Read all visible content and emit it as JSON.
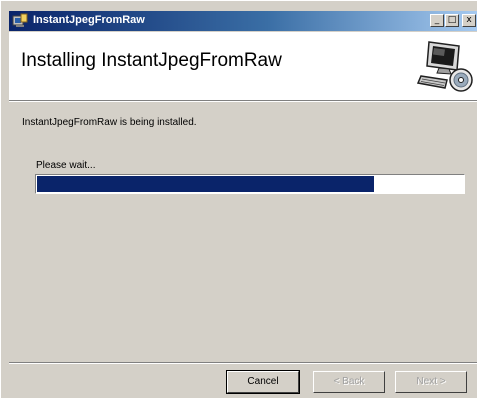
{
  "window": {
    "title": "InstantJpegFromRaw",
    "minimize_glyph": "_",
    "maximize_glyph": "□",
    "close_glyph": "x"
  },
  "header": {
    "title": "Installing InstantJpegFromRaw",
    "art_icon": "computer-with-disc-icon"
  },
  "body": {
    "status": "InstantJpegFromRaw is being installed.",
    "wait": "Please wait...",
    "progress_percent": 79
  },
  "buttons": {
    "cancel": "Cancel",
    "back": "< Back",
    "next": "Next >"
  },
  "colors": {
    "progress_fill": "#0a246a",
    "titlebar_start": "#0a246a",
    "titlebar_end": "#a6caf0"
  }
}
